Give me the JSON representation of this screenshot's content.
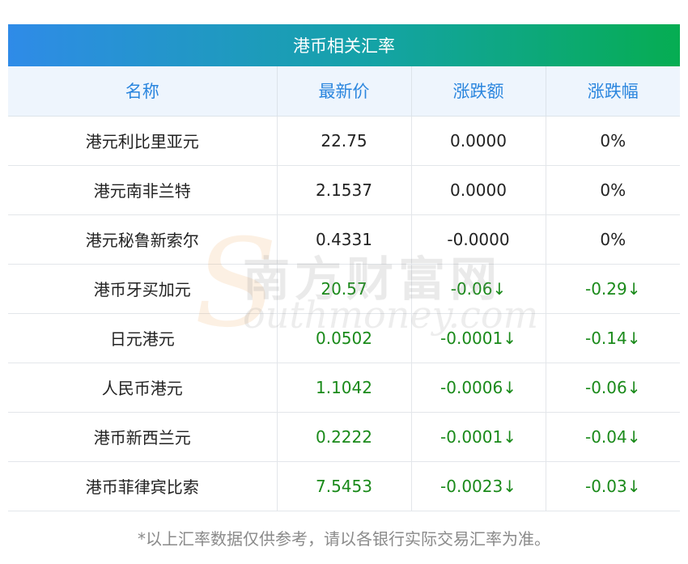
{
  "title": "港币相关汇率",
  "columns": [
    "名称",
    "最新价",
    "涨跌额",
    "涨跌幅"
  ],
  "rows": [
    {
      "name": "港元利比里亚元",
      "price": "22.75",
      "change": "0.0000",
      "pct": "0%",
      "trend": "flat"
    },
    {
      "name": "港元南非兰特",
      "price": "2.1537",
      "change": "0.0000",
      "pct": "0%",
      "trend": "flat"
    },
    {
      "name": "港元秘鲁新索尔",
      "price": "0.4331",
      "change": "-0.0000",
      "pct": "0%",
      "trend": "flat"
    },
    {
      "name": "港币牙买加元",
      "price": "20.57",
      "change": "-0.06↓",
      "pct": "-0.29↓",
      "trend": "down"
    },
    {
      "name": "日元港元",
      "price": "0.0502",
      "change": "-0.0001↓",
      "pct": "-0.14↓",
      "trend": "down"
    },
    {
      "name": "人民币港元",
      "price": "1.1042",
      "change": "-0.0006↓",
      "pct": "-0.06↓",
      "trend": "down"
    },
    {
      "name": "港币新西兰元",
      "price": "0.2222",
      "change": "-0.0001↓",
      "pct": "-0.04↓",
      "trend": "down"
    },
    {
      "name": "港币菲律宾比索",
      "price": "7.5453",
      "change": "-0.0023↓",
      "pct": "-0.03↓",
      "trend": "down"
    }
  ],
  "note": "*以上汇率数据仅供参考，请以各银行实际交易汇率为准。",
  "watermark": {
    "mark": "S",
    "cn": "南方财富网",
    "en": "outhmoney.com"
  },
  "colors": {
    "header_text": "#2b86de",
    "down": "#1a8a1a",
    "gradient_start": "#2f8be8",
    "gradient_end": "#06ad52"
  }
}
